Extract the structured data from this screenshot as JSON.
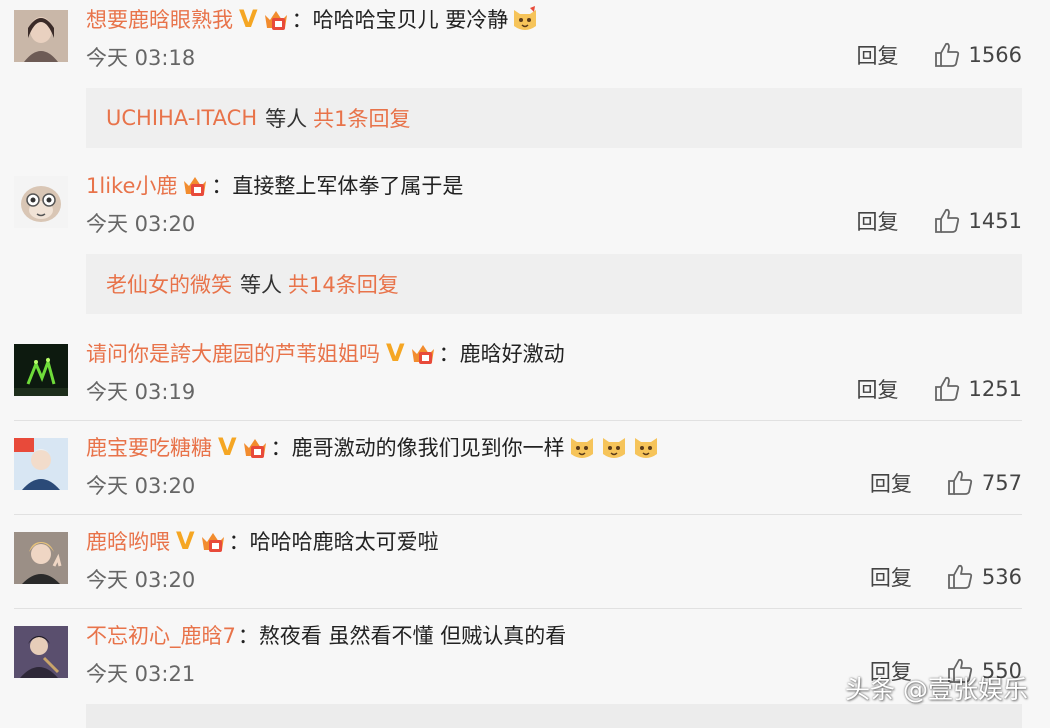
{
  "labels": {
    "reply": "回复",
    "others": "等人"
  },
  "comments": [
    {
      "username": "想要鹿晗眼熟我",
      "text": "哈哈哈宝贝儿 要冷静",
      "time": "今天 03:18",
      "likes": "1566",
      "verified": true,
      "replies": {
        "name": "UCHIHA-ITACH",
        "total": "共1条回复"
      }
    },
    {
      "username": "1like小鹿",
      "text": "直接整上军体拳了属于是",
      "time": "今天 03:20",
      "likes": "1451",
      "verified": false,
      "replies": {
        "name": "老仙女的微笑",
        "total": "共14条回复"
      }
    },
    {
      "username": "请问你是誇大鹿园的芦苇姐姐吗",
      "text": "鹿晗好激动",
      "time": "今天 03:19",
      "likes": "1251",
      "verified": true
    },
    {
      "username": "鹿宝要吃糖糖",
      "text": "鹿哥激动的像我们见到你一样",
      "time": "今天 03:20",
      "likes": "757",
      "verified": true
    },
    {
      "username": "鹿晗哟喂",
      "text": "哈哈哈鹿晗太可爱啦",
      "time": "今天 03:20",
      "likes": "536",
      "verified": true
    },
    {
      "username": "不忘初心_鹿晗7",
      "text": "熬夜看 虽然看不懂 但贼认真的看",
      "time": "今天 03:21",
      "likes": "550",
      "verified": false
    }
  ],
  "watermark": "头条 @壹张娱乐",
  "icons": {
    "verified": "verified-v-icon",
    "member": "crown-member-icon",
    "like": "thumbs-up-icon",
    "emoji": "cat-emoji-icon"
  },
  "colors": {
    "username": "#e8734a",
    "verified": "#f5a623",
    "background": "#f7f7f7",
    "reply_box": "#efefef"
  }
}
